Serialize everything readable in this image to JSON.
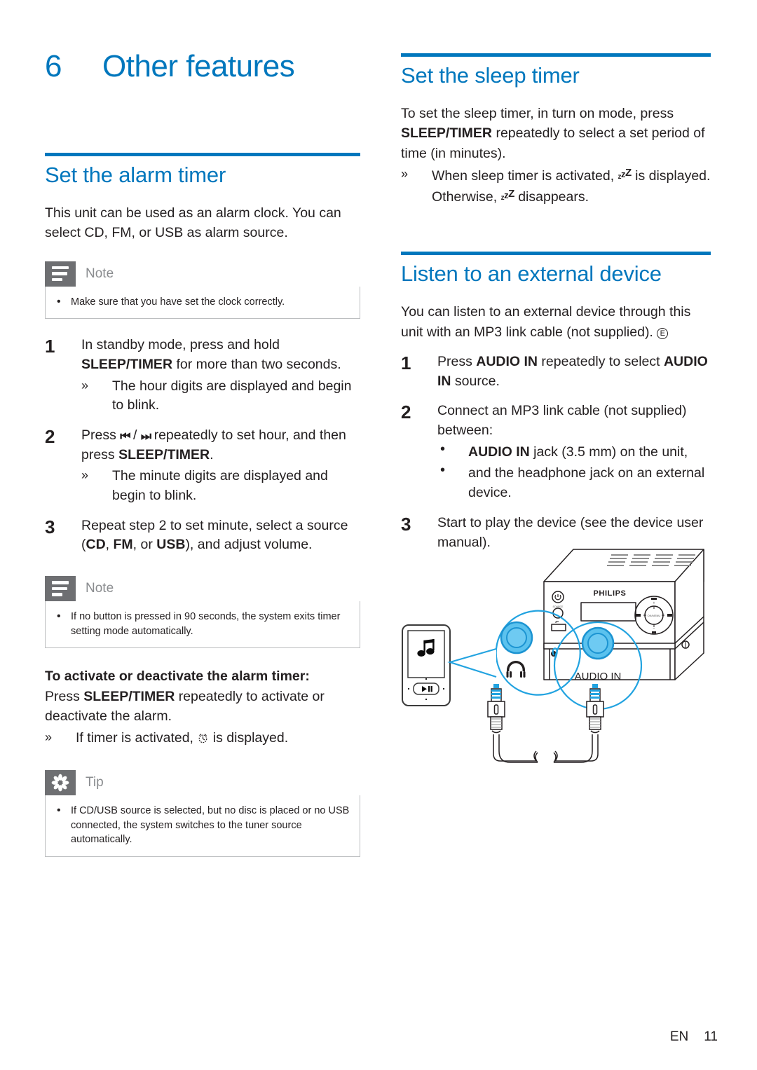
{
  "brand_blue": "#0077bd",
  "gray_tab": "#6e6f72",
  "chapter": {
    "number": "6",
    "title": "Other features"
  },
  "left_column": {
    "section": {
      "heading": "Set the alarm timer"
    },
    "intro": "This unit can be used as an alarm clock. You can select CD, FM, or USB as alarm source.",
    "note1": {
      "label": "Note",
      "icon": "note-lines-icon",
      "items": [
        "Make sure that you have set the clock correctly."
      ]
    },
    "steps": [
      {
        "number": "1",
        "text_a": "In standby mode, press and hold ",
        "bold_a": "SLEEP/",
        "bold_b": "TIMER",
        "text_b": " for more than two seconds.",
        "sub": "The hour digits are displayed and begin to blink.",
        "sub_marker": "»"
      },
      {
        "number": "2",
        "text_a": "Press ",
        "glyph_prev": "⏮",
        "sep": " / ",
        "glyph_next": "⏭",
        "text_b": " repeatedly to set hour, and then press ",
        "bold_a": "SLEEP/TIMER",
        "text_c": ".",
        "sub": "The minute digits are displayed and begin to blink.",
        "sub_marker": "»"
      },
      {
        "number": "3",
        "text_a": "Repeat step 2 to set minute, select a source (",
        "bold_a": "CD",
        "text_b": ", ",
        "bold_b": "FM",
        "text_c": ", or ",
        "bold_c": "USB",
        "text_d": "), and adjust volume."
      }
    ],
    "note2": {
      "label": "Note",
      "icon": "note-lines-icon",
      "items": [
        "If no button is pressed in 90 seconds, the system exits timer setting mode automatically."
      ]
    },
    "activate": {
      "title": "To activate or deactivate the alarm timer:",
      "text_a": "Press ",
      "bold_a": "SLEEP/TIMER",
      "text_b": " repeatedly to activate or deactivate the alarm.",
      "sub_marker": "»",
      "sub_a": "If timer is activated, ",
      "sub_icon": "alarm-clock-icon",
      "sub_b": " is displayed."
    },
    "tip": {
      "label": "Tip",
      "icon": "asterisk-icon",
      "items": [
        "If CD/USB source is selected, but no disc is placed or no USB connected, the system switches to the tuner source automatically."
      ]
    }
  },
  "right_column": {
    "sleep_section": {
      "heading": "Set the sleep timer",
      "body_a": "To set the sleep timer, in turn on mode, press ",
      "bold_a": "SLEEP/TIMER",
      "body_b": " repeatedly to select a set period of time (in minutes).",
      "sub_marker": "»",
      "sub_a": "When sleep timer is activated, ",
      "sub_icon": "sleep-zzz-icon",
      "sub_b": " is displayed. Otherwise, ",
      "sub_c": " disappears."
    },
    "listen_section": {
      "heading": "Listen to an external device",
      "body_a": "You can listen to an external device through this unit with an MP3 link cable (not supplied). ",
      "body_ref": "E",
      "steps": [
        {
          "number": "1",
          "text_a": "Press ",
          "bold_a": "AUDIO IN",
          "text_b": " repeatedly to select ",
          "bold_b": "AUDIO IN",
          "text_c": " source."
        },
        {
          "number": "2",
          "text_a": "Connect an MP3 link cable (not supplied) between:",
          "bullets": [
            {
              "bold": "AUDIO IN",
              "text": " jack (3.5 mm) on the unit,"
            },
            {
              "bold": "",
              "text": "and the headphone jack on an external device."
            }
          ]
        },
        {
          "number": "3",
          "text_a": "Start to play the device (see the device user manual)."
        }
      ]
    },
    "figure": {
      "unit_brand": "PHILIPS",
      "callout_headphone_icon": "headphone-icon",
      "callout_audio_in_label": "AUDIO IN",
      "mp3_screen_icon": "music-note-icon",
      "mp3_play_icon": "play-pause-icon"
    }
  },
  "footer": {
    "locale": "EN",
    "page": "11"
  }
}
